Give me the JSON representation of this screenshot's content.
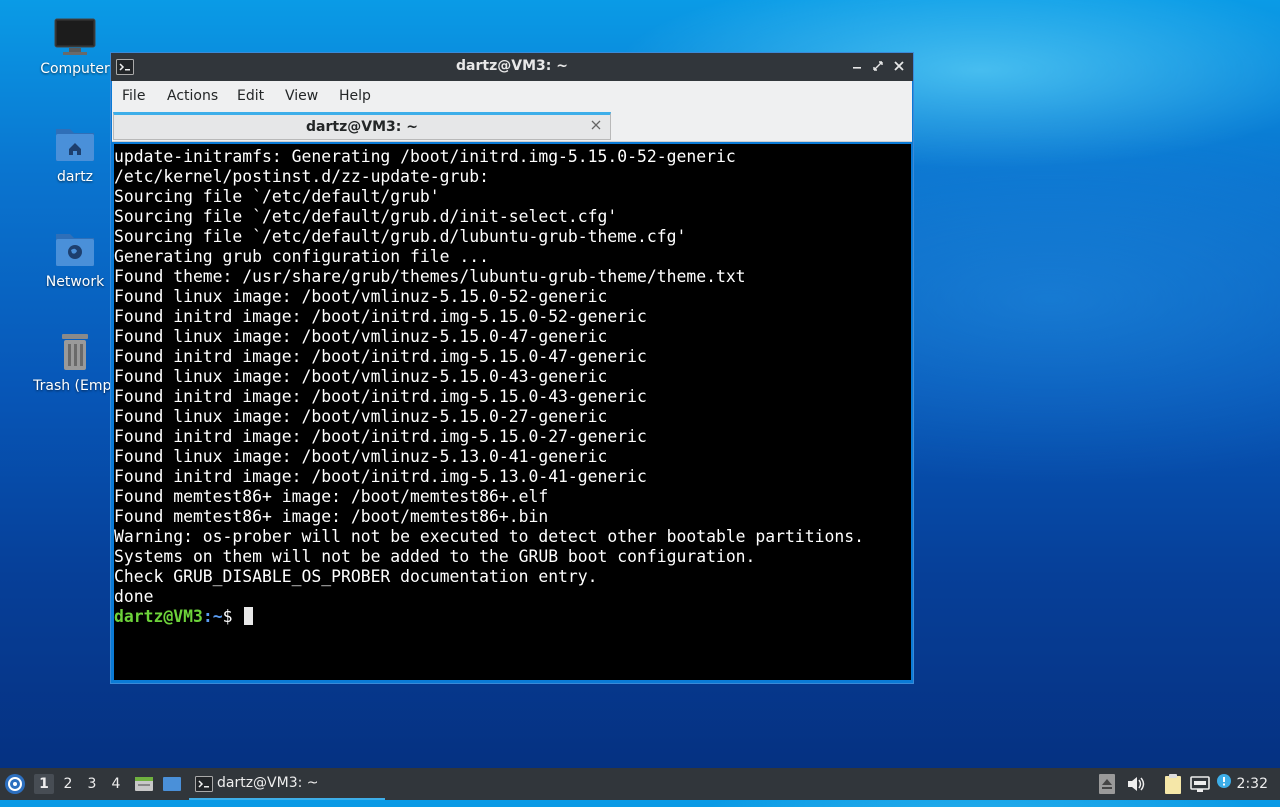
{
  "desktop": {
    "icons": [
      {
        "label": "Computer"
      },
      {
        "label": "dartz"
      },
      {
        "label": "Network"
      },
      {
        "label": "Trash (Empt"
      }
    ]
  },
  "window": {
    "title": "dartz@VM3: ~",
    "menu": [
      "File",
      "Actions",
      "Edit",
      "View",
      "Help"
    ],
    "tab_label": "dartz@VM3: ~",
    "terminal_lines": [
      "update-initramfs: Generating /boot/initrd.img-5.15.0-52-generic",
      "/etc/kernel/postinst.d/zz-update-grub:",
      "Sourcing file `/etc/default/grub'",
      "Sourcing file `/etc/default/grub.d/init-select.cfg'",
      "Sourcing file `/etc/default/grub.d/lubuntu-grub-theme.cfg'",
      "Generating grub configuration file ...",
      "Found theme: /usr/share/grub/themes/lubuntu-grub-theme/theme.txt",
      "Found linux image: /boot/vmlinuz-5.15.0-52-generic",
      "Found initrd image: /boot/initrd.img-5.15.0-52-generic",
      "Found linux image: /boot/vmlinuz-5.15.0-47-generic",
      "Found initrd image: /boot/initrd.img-5.15.0-47-generic",
      "Found linux image: /boot/vmlinuz-5.15.0-43-generic",
      "Found initrd image: /boot/initrd.img-5.15.0-43-generic",
      "Found linux image: /boot/vmlinuz-5.15.0-27-generic",
      "Found initrd image: /boot/initrd.img-5.15.0-27-generic",
      "Found linux image: /boot/vmlinuz-5.13.0-41-generic",
      "Found initrd image: /boot/initrd.img-5.13.0-41-generic",
      "Found memtest86+ image: /boot/memtest86+.elf",
      "Found memtest86+ image: /boot/memtest86+.bin",
      "Warning: os-prober will not be executed to detect other bootable partitions.",
      "Systems on them will not be added to the GRUB boot configuration.",
      "Check GRUB_DISABLE_OS_PROBER documentation entry.",
      "done"
    ],
    "prompt": {
      "user_host": "dartz@VM3",
      "sep": ":",
      "path": "~",
      "symbol": "$"
    }
  },
  "taskbar": {
    "workspaces": [
      "1",
      "2",
      "3",
      "4"
    ],
    "active_workspace": "1",
    "task_label": "dartz@VM3: ~",
    "clock": "2:32"
  },
  "colors": {
    "titlebar": "#31363b",
    "accent": "#3daee9",
    "prompt_user": "#6dd33a",
    "prompt_path": "#5a9cf2"
  },
  "icons": [
    "computer-icon",
    "home-folder-icon",
    "network-folder-icon",
    "trash-icon",
    "terminal-icon",
    "lubuntu-menu-icon",
    "file-manager-icon",
    "show-desktop-icon",
    "eject-icon",
    "volume-icon",
    "clipboard-icon",
    "network-icon",
    "update-notifier-icon"
  ]
}
